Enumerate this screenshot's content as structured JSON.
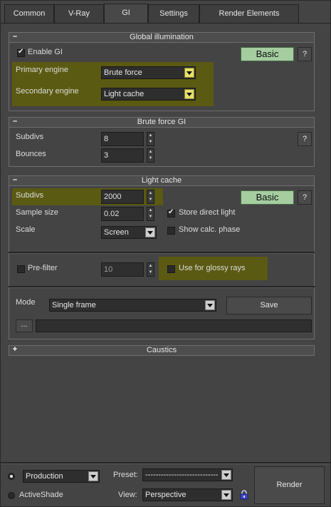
{
  "tabs": [
    "Common",
    "V-Ray",
    "GI",
    "Settings",
    "Render Elements"
  ],
  "global_illumination": {
    "title": "Global illumination",
    "collapse_sign": "–",
    "enable_gi_label": "Enable GI",
    "enable_gi_checked": true,
    "mode_button": "Basic",
    "help_button": "?",
    "primary_engine_label": "Primary engine",
    "primary_engine_value": "Brute force",
    "secondary_engine_label": "Secondary engine",
    "secondary_engine_value": "Light cache"
  },
  "brute_force_gi": {
    "title": "Brute force GI",
    "collapse_sign": "–",
    "subdivs_label": "Subdivs",
    "subdivs_value": "8",
    "bounces_label": "Bounces",
    "bounces_value": "3",
    "help_button": "?"
  },
  "light_cache": {
    "title": "Light cache",
    "collapse_sign": "–",
    "subdivs_label": "Subdivs",
    "subdivs_value": "2000",
    "mode_button": "Basic",
    "help_button": "?",
    "sample_size_label": "Sample size",
    "sample_size_value": "0.02",
    "scale_label": "Scale",
    "scale_value": "Screen",
    "store_direct_light_label": "Store direct light",
    "store_direct_light_checked": true,
    "show_calc_phase_label": "Show calc. phase",
    "show_calc_phase_checked": false,
    "prefilter_label": "Pre-filter",
    "prefilter_checked": false,
    "prefilter_value": "10",
    "glossy_rays_label": "Use for glossy rays",
    "glossy_rays_checked": false,
    "mode_label": "Mode",
    "mode_value": "Single frame",
    "save_button": "Save",
    "browse_button": "...",
    "file_path": ""
  },
  "caustics": {
    "title": "Caustics",
    "collapse_sign": "+"
  },
  "bottom": {
    "production_label": "Production",
    "activeshade_label": "ActiveShade",
    "production_selected": true,
    "preset_label": "Preset:",
    "preset_value": "----------------------------",
    "view_label": "View:",
    "view_value": "Perspective",
    "render_button": "Render",
    "lock_icon": "lock-icon"
  },
  "colors": {
    "panel_bg": "#444444",
    "highlight": "#5a5a12",
    "basic_button": "#a5cda0",
    "combo_arrow_yellow": "#e7e06a"
  }
}
